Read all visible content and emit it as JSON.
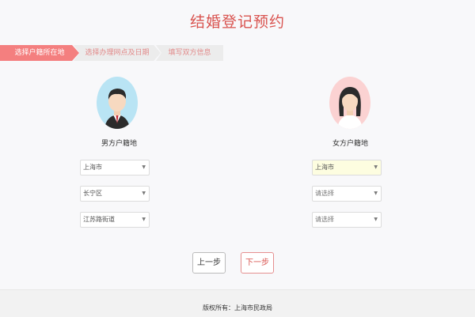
{
  "page": {
    "title": "结婚登记预约"
  },
  "steps": [
    {
      "label": "选择户籍所在地"
    },
    {
      "label": "选择办理网点及日期"
    },
    {
      "label": "填写双方信息"
    }
  ],
  "male": {
    "label": "男方户籍地",
    "selects": [
      "上海市",
      "长宁区",
      "江苏路街道"
    ]
  },
  "female": {
    "label": "女方户籍地",
    "selects": [
      "上海市",
      "请选择",
      "请选择"
    ]
  },
  "buttons": {
    "prev": "上一步",
    "next": "下一步"
  },
  "footer": {
    "copyright": "版权所有：上海市民政局"
  },
  "colors": {
    "accent": "#d9534f",
    "step_active": "#f47f7f",
    "step_inactive": "#ececec",
    "male_avatar_bg": "#b9e4f4",
    "female_avatar_bg": "#fbd2d2"
  }
}
